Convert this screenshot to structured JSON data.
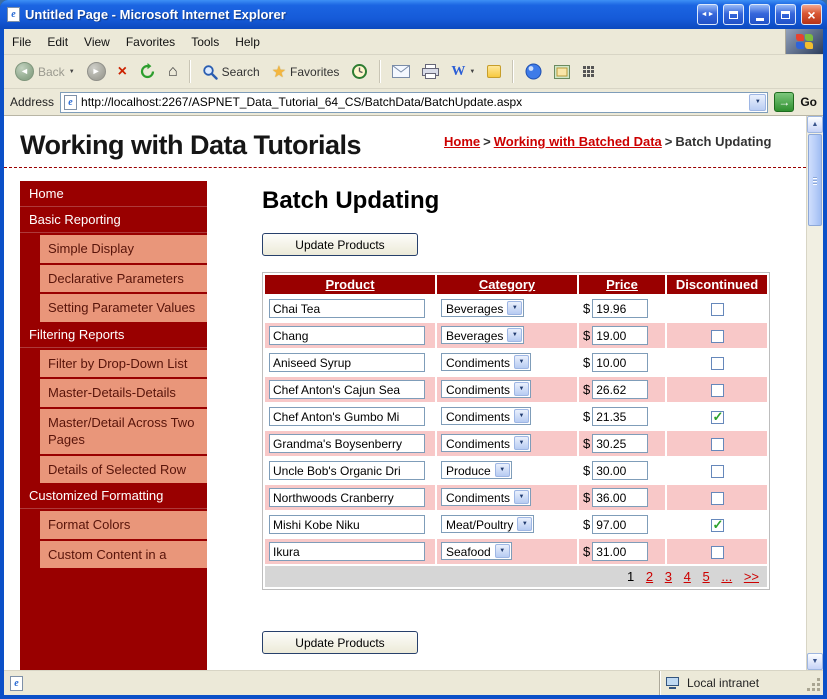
{
  "window": {
    "title": "Untitled Page - Microsoft Internet Explorer"
  },
  "menu": {
    "items": [
      "File",
      "Edit",
      "View",
      "Favorites",
      "Tools",
      "Help"
    ]
  },
  "toolbar": {
    "back_label": "Back",
    "search_label": "Search",
    "favorites_label": "Favorites"
  },
  "address": {
    "label": "Address",
    "url": "http://localhost:2267/ASPNET_Data_Tutorial_64_CS/BatchData/BatchUpdate.aspx",
    "go_label": "Go"
  },
  "status": {
    "zone_label": "Local intranet"
  },
  "icons": {
    "ie_logo": "e",
    "close": "×",
    "chevrons": "◄►",
    "back": "◄",
    "forward": "►",
    "stop": "×",
    "home": "⌂",
    "favorites_star": "★",
    "word_w": "W",
    "dropdown_arrow": "▼",
    "up_arrow": "▲",
    "down_arrow": "▼",
    "go_arrow": "→",
    "check": "✓"
  },
  "page": {
    "site_title": "Working with Data Tutorials",
    "breadcrumb_sep": ">",
    "breadcrumb": [
      {
        "label": "Home"
      },
      {
        "label": "Working with Batched Data"
      },
      {
        "label": "Batch Updating"
      }
    ],
    "heading": "Batch Updating",
    "update_button_label": "Update Products",
    "sidebar": [
      {
        "label": "Home",
        "type": "section"
      },
      {
        "label": "Basic Reporting",
        "type": "section"
      },
      {
        "label": "Simple Display",
        "type": "sub"
      },
      {
        "label": "Declarative Parameters",
        "type": "sub"
      },
      {
        "label": "Setting Parameter Values",
        "type": "sub"
      },
      {
        "label": "Filtering Reports",
        "type": "section"
      },
      {
        "label": "Filter by Drop-Down List",
        "type": "sub"
      },
      {
        "label": "Master-Details-Details",
        "type": "sub"
      },
      {
        "label": "Master/Detail Across Two Pages",
        "type": "sub"
      },
      {
        "label": "Details of Selected Row",
        "type": "sub"
      },
      {
        "label": "Customized Formatting",
        "type": "section"
      },
      {
        "label": "Format Colors",
        "type": "sub"
      },
      {
        "label": "Custom Content in a",
        "type": "sub"
      }
    ],
    "table": {
      "headers": [
        "Product",
        "Category",
        "Price",
        "Discontinued"
      ],
      "currency": "$",
      "rows": [
        {
          "product": "Chai Tea",
          "category": "Beverages",
          "price": "19.96",
          "discontinued": false
        },
        {
          "product": "Chang",
          "category": "Beverages",
          "price": "19.00",
          "discontinued": false
        },
        {
          "product": "Aniseed Syrup",
          "category": "Condiments",
          "price": "10.00",
          "discontinued": false
        },
        {
          "product": "Chef Anton's Cajun Sea",
          "category": "Condiments",
          "price": "26.62",
          "discontinued": false
        },
        {
          "product": "Chef Anton's Gumbo Mi",
          "category": "Condiments",
          "price": "21.35",
          "discontinued": true
        },
        {
          "product": "Grandma's Boysenberry",
          "category": "Condiments",
          "price": "30.25",
          "discontinued": false
        },
        {
          "product": "Uncle Bob's Organic Dri",
          "category": "Produce",
          "price": "30.00",
          "discontinued": false
        },
        {
          "product": "Northwoods Cranberry",
          "category": "Condiments",
          "price": "36.00",
          "discontinued": false
        },
        {
          "product": "Mishi Kobe Niku",
          "category": "Meat/Poultry",
          "price": "97.00",
          "discontinued": true
        },
        {
          "product": "Ikura",
          "category": "Seafood",
          "price": "31.00",
          "discontinued": false
        }
      ],
      "pager": [
        "1",
        "2",
        "3",
        "4",
        "5",
        "...",
        ">>"
      ]
    }
  },
  "colors": {
    "maroon": "#990000",
    "salmon": "#E9967A",
    "row_pink": "#F8C8C8",
    "link_red": "#CC0000",
    "pager_gray": "#D6D6D6"
  }
}
